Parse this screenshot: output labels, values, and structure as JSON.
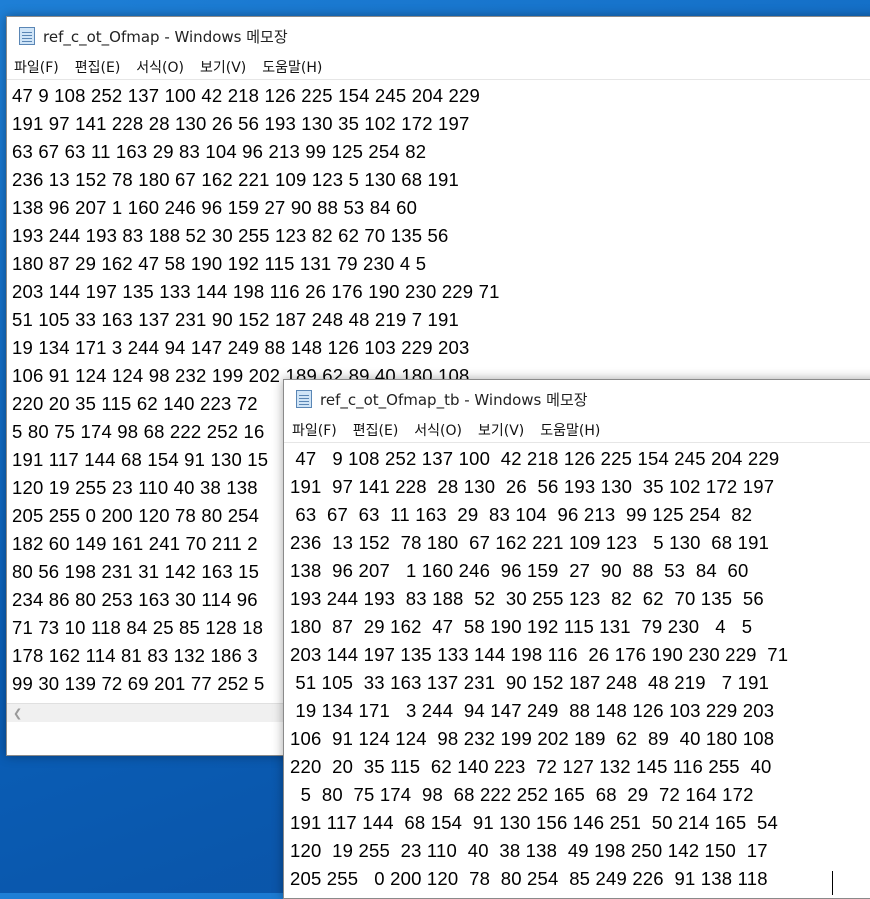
{
  "window_back": {
    "title": "ref_c_ot_Ofmap - Windows 메모장",
    "menu": [
      "파일(F)",
      "편집(E)",
      "서식(O)",
      "보기(V)",
      "도움말(H)"
    ],
    "lines": [
      "47 9 108 252 137 100 42 218 126 225 154 245 204 229",
      "191 97 141 228 28 130 26 56 193 130 35 102 172 197",
      "63 67 63 11 163 29 83 104 96 213 99 125 254 82",
      "236 13 152 78 180 67 162 221 109 123 5 130 68 191",
      "138 96 207 1 160 246 96 159 27 90 88 53 84 60",
      "193 244 193 83 188 52 30 255 123 82 62 70 135 56",
      "180 87 29 162 47 58 190 192 115 131 79 230 4 5",
      "203 144 197 135 133 144 198 116 26 176 190 230 229 71",
      "51 105 33 163 137 231 90 152 187 248 48 219 7 191",
      "19 134 171 3 244 94 147 249 88 148 126 103 229 203",
      "106 91 124 124 98 232 199 202 189 62 89 40 180 108",
      "220 20 35 115 62 140 223 72",
      "5 80 75 174 98 68 222 252 16",
      "191 117 144 68 154 91 130 15",
      "120 19 255 23 110 40 38 138",
      "205 255 0 200 120 78 80 254",
      "182 60 149 161 241 70 211 2",
      "80 56 198 231 31 142 163 15",
      "234 86 80 253 163 30 114 96",
      "71 73 10 118 84 25 85 128 18",
      "178 162 114 81 83 132 186 3",
      "99 30 139 72 69 201 77 252 5"
    ]
  },
  "window_front": {
    "title": "ref_c_ot_Ofmap_tb - Windows 메모장",
    "menu": [
      "파일(F)",
      "편집(E)",
      "서식(O)",
      "보기(V)",
      "도움말(H)"
    ],
    "lines": [
      " 47   9 108 252 137 100  42 218 126 225 154 245 204 229",
      "191  97 141 228  28 130  26  56 193 130  35 102 172 197",
      " 63  67  63  11 163  29  83 104  96 213  99 125 254  82",
      "236  13 152  78 180  67 162 221 109 123   5 130  68 191",
      "138  96 207   1 160 246  96 159  27  90  88  53  84  60",
      "193 244 193  83 188  52  30 255 123  82  62  70 135  56",
      "180  87  29 162  47  58 190 192 115 131  79 230   4   5",
      "203 144 197 135 133 144 198 116  26 176 190 230 229  71",
      " 51 105  33 163 137 231  90 152 187 248  48 219   7 191",
      " 19 134 171   3 244  94 147 249  88 148 126 103 229 203",
      "106  91 124 124  98 232 199 202 189  62  89  40 180 108",
      "220  20  35 115  62 140 223  72 127 132 145 116 255  40",
      "  5  80  75 174  98  68 222 252 165  68  29  72 164 172",
      "191 117 144  68 154  91 130 156 146 251  50 214 165  54",
      "120  19 255  23 110  40  38 138  49 198 250 142 150  17",
      "205 255   0 200 120  78  80 254  85 249 226  91 138 118"
    ]
  }
}
